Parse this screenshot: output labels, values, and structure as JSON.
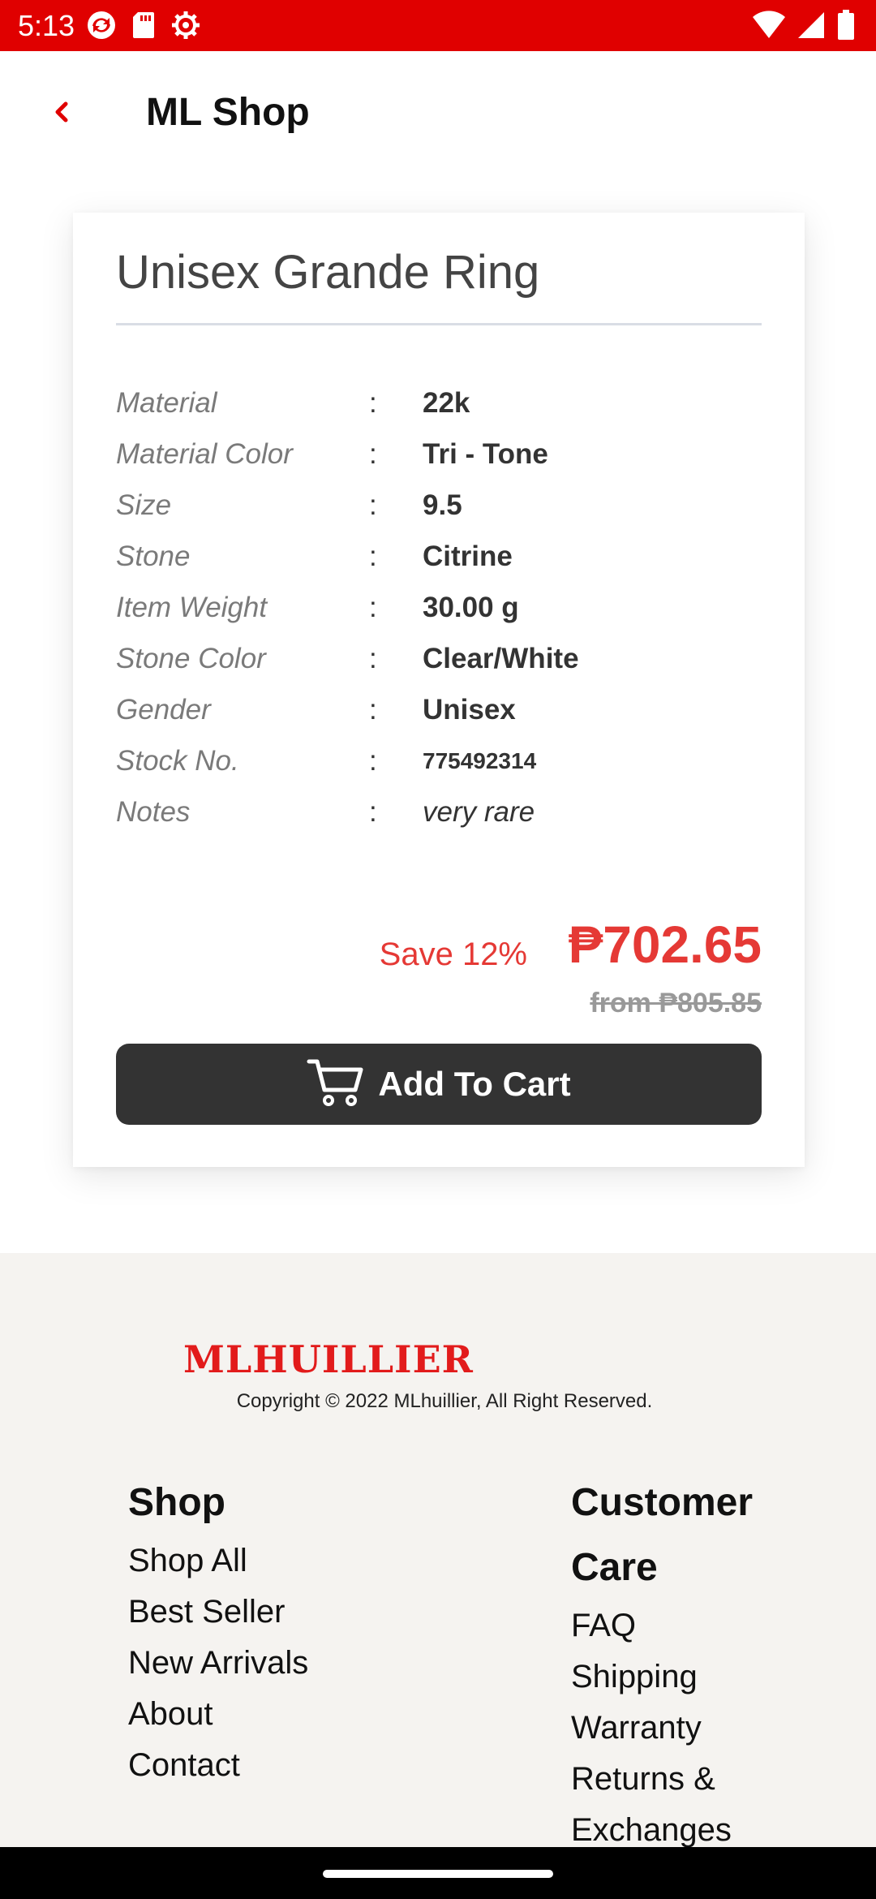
{
  "status_bar": {
    "time": "5:13",
    "left_icons": [
      "sync-icon",
      "sd-card-icon",
      "settings-icon"
    ],
    "right_icons": [
      "wifi-icon",
      "signal-icon",
      "battery-icon"
    ]
  },
  "app_bar": {
    "title": "ML Shop",
    "back_icon": "chevron-left-icon"
  },
  "product": {
    "name": "Unisex Grande Ring",
    "specs": [
      {
        "label": "Material",
        "value": "22k"
      },
      {
        "label": "Material Color",
        "value": "Tri - Tone"
      },
      {
        "label": "Size",
        "value": "9.5"
      },
      {
        "label": "Stone",
        "value": "Citrine"
      },
      {
        "label": "Item Weight",
        "value": "30.00 g"
      },
      {
        "label": "Stone Color",
        "value": "Clear/White"
      },
      {
        "label": "Gender",
        "value": "Unisex"
      },
      {
        "label": "Stock No.",
        "value": "775492314"
      },
      {
        "label": "Notes",
        "value": "very rare"
      }
    ],
    "separator": ":",
    "save_label": "Save 12%",
    "price": "₱702.65",
    "old_price": "from ₱805.85",
    "add_to_cart_label": "Add To Cart"
  },
  "footer": {
    "brand": "MLHUILLIER",
    "copyright": "Copyright © 2022 MLhuillier, All Right Reserved.",
    "shop": {
      "heading": "Shop",
      "links": [
        "Shop All",
        "Best Seller",
        "New Arrivals",
        "About",
        "Contact"
      ]
    },
    "customer_care": {
      "heading_line1": "Customer",
      "heading_line2": "Care",
      "links": [
        "FAQ",
        "Shipping",
        "Warranty",
        "Returns &",
        "Exchanges"
      ]
    }
  },
  "colors": {
    "brand_red": "#e00000",
    "price_red": "#e53935",
    "button_dark": "#333333",
    "footer_bg": "#f5f3f0"
  }
}
